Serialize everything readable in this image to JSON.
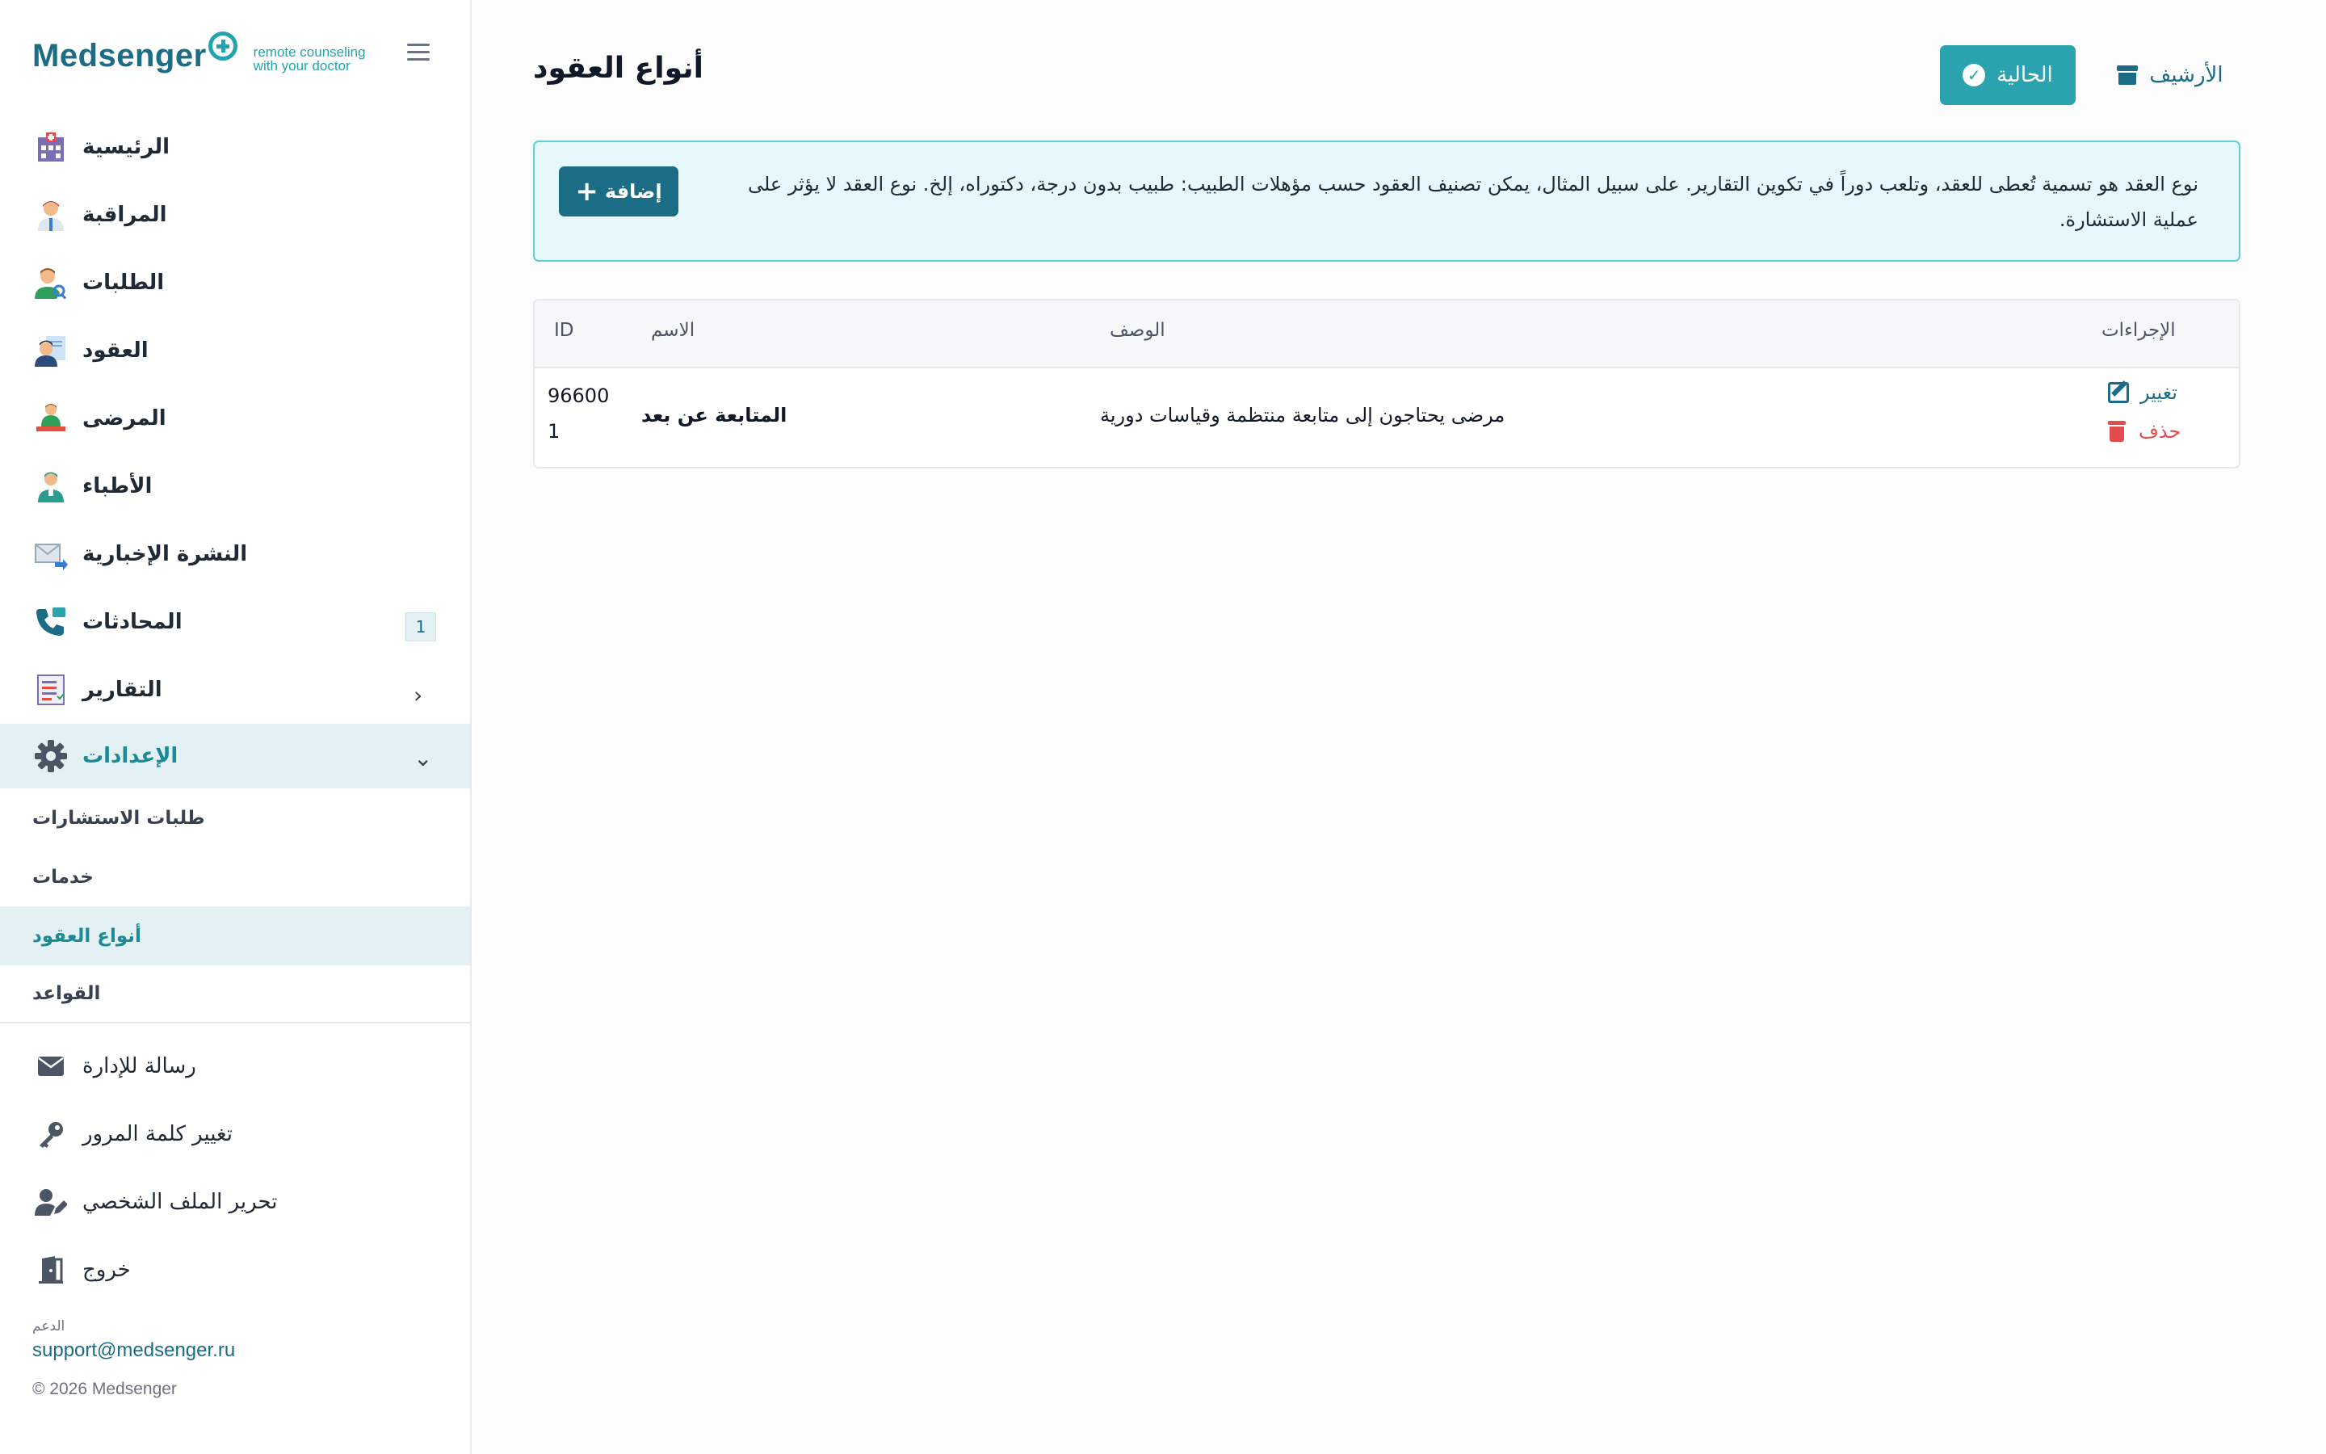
{
  "brand": {
    "name": "Medsenger",
    "tagline_1": "remote counseling",
    "tagline_2": "with your doctor"
  },
  "sidebar": {
    "items": [
      {
        "label": "الرئيسية",
        "icon": "hospital-icon"
      },
      {
        "label": "المراقبة",
        "icon": "doctor-icon"
      },
      {
        "label": "الطلبات",
        "icon": "user-search-icon"
      },
      {
        "label": "العقود",
        "icon": "contract-icon"
      },
      {
        "label": "المرضى",
        "icon": "patients-icon"
      },
      {
        "label": "الأطباء",
        "icon": "doctors-icon"
      },
      {
        "label": "النشرة الإخبارية",
        "icon": "mail-forward-icon"
      },
      {
        "label": "المحادثات",
        "icon": "phone-chat-icon",
        "badge": "1"
      },
      {
        "label": "التقارير",
        "icon": "report-icon"
      },
      {
        "label": "الإعدادات",
        "icon": "gear-icon"
      }
    ],
    "settings_sub": [
      {
        "label": "طلبات الاستشارات"
      },
      {
        "label": "خدمات"
      },
      {
        "label": "أنواع العقود"
      },
      {
        "label": "القواعد"
      }
    ],
    "bottom": [
      {
        "label": "رسالة للإدارة",
        "icon": "envelope-icon"
      },
      {
        "label": "تغيير كلمة المرور",
        "icon": "key-icon"
      },
      {
        "label": "تحرير الملف الشخصي",
        "icon": "user-edit-icon"
      },
      {
        "label": "خروج",
        "icon": "door-exit-icon"
      }
    ],
    "support_title": "الدعم",
    "support_email": "support@medsenger.ru",
    "copyright": "© 2026 Medsenger"
  },
  "main": {
    "title": "أنواع العقود",
    "current_button": "الحالية",
    "archive_button": "الأرشيف",
    "info_text": "نوع العقد هو تسمية تُعطى للعقد، وتلعب دوراً في تكوين التقارير. على سبيل المثال، يمكن تصنيف العقود حسب مؤهلات الطبيب: طبيب بدون درجة، دكتوراه، إلخ. نوع العقد لا يؤثر على عملية الاستشارة.",
    "add_button": "إضافة",
    "table": {
      "headers": {
        "id": "ID",
        "name": "الاسم",
        "description": "الوصف",
        "actions": "الإجراءات"
      },
      "rows": [
        {
          "id_line1": "96600",
          "id_line2": "1",
          "name": "المتابعة عن بعد",
          "description": "مرضى يحتاجون إلى متابعة منتظمة وقياسات دورية",
          "edit": "تغيير",
          "delete": "حذف"
        }
      ]
    }
  },
  "colors": {
    "primary": "#1b6c85",
    "accent": "#2aa3ae",
    "info_bg": "#e6f8fb",
    "danger": "#e24c4c"
  }
}
